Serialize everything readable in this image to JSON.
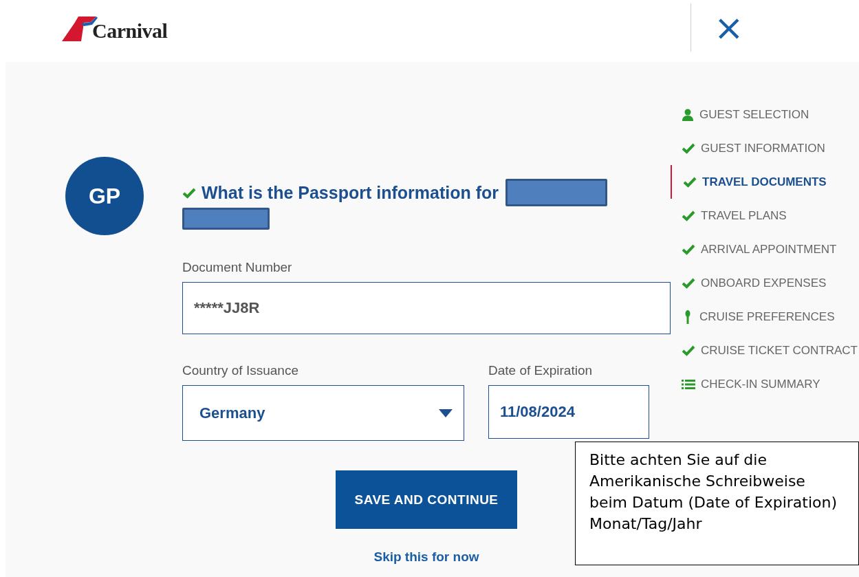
{
  "header": {
    "logo_text": "Carnival",
    "close_label": "×"
  },
  "avatar": {
    "initials": "GP"
  },
  "form": {
    "heading": "What is the Passport information for",
    "heading_checked": true,
    "document_number": {
      "label": "Document Number",
      "value": "*****JJ8R"
    },
    "country": {
      "label": "Country of Issuance",
      "value": "Germany"
    },
    "expiration": {
      "label": "Date of Expiration",
      "value": "11/08/2024"
    },
    "submit": "SAVE AND CONTINUE",
    "skip": "Skip this for now"
  },
  "steps": [
    {
      "label": "GUEST SELECTION",
      "kind": "person",
      "selected": false
    },
    {
      "label": "GUEST INFORMATION",
      "kind": "check",
      "selected": false
    },
    {
      "label": "TRAVEL DOCUMENTS",
      "kind": "check",
      "selected": true
    },
    {
      "label": "TRAVEL PLANS",
      "kind": "check",
      "selected": false
    },
    {
      "label": "ARRIVAL APPOINTMENT",
      "kind": "check",
      "selected": false
    },
    {
      "label": "ONBOARD EXPENSES",
      "kind": "check",
      "selected": false
    },
    {
      "label": "CRUISE PREFERENCES",
      "kind": "pin",
      "selected": false
    },
    {
      "label": "CRUISE TICKET CONTRACT",
      "kind": "check",
      "selected": false
    },
    {
      "label": "CHECK-IN SUMMARY",
      "kind": "list",
      "selected": false
    }
  ],
  "note": "Bitte achten Sie auf die Amerikanische Schreibweise beim Datum (Date of Expiration) Monat/Tag/Jahr"
}
